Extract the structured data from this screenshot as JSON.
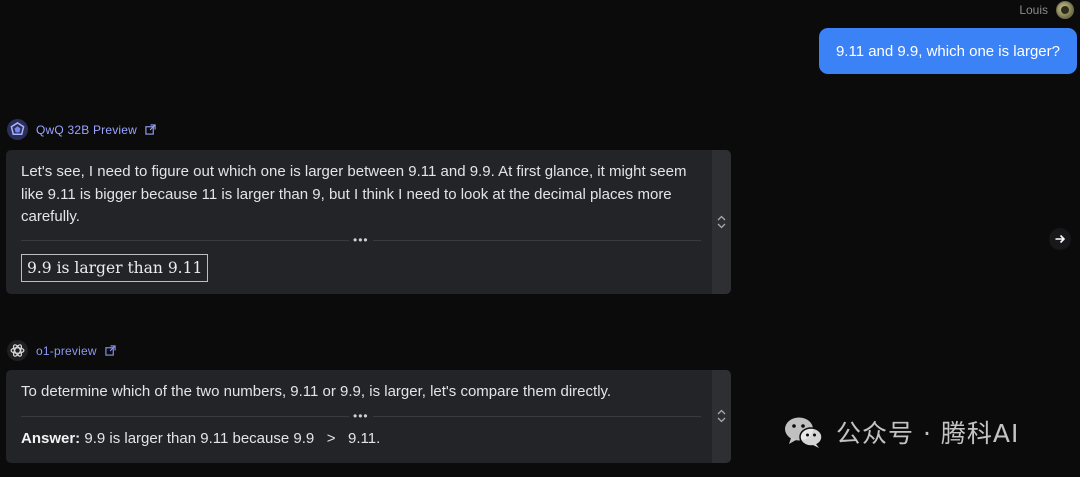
{
  "user": {
    "name": "Louis",
    "message": "9.11 and 9.9, which one is larger?"
  },
  "responses": [
    {
      "model": "QwQ 32B Preview",
      "text": "Let's see, I need to figure out which one is larger between 9.11 and 9.9. At first glance, it might seem like 9.11 is bigger because 11 is larger than 9, but I think I need to look at the decimal places more carefully.",
      "collapsed_indicator": "•••",
      "boxed_answer": "9.9 is larger than 9.11"
    },
    {
      "model": "o1-preview",
      "text": "To determine which of the two numbers, 9.11 or 9.9, is larger, let's compare them directly.",
      "collapsed_indicator": "•••",
      "answer_label": "Answer:",
      "answer_text": " 9.9 is larger than 9.11 because 9.9   >   9.11."
    }
  ],
  "watermark": {
    "text": "公众号 · 腾科AI",
    "icon": "wechat-logo"
  },
  "icons": {
    "external_link": "external-link-icon",
    "expand": "chevron-up-down-icon",
    "next": "arrow-right-icon"
  },
  "colors": {
    "background": "#0b0b0c",
    "user_bubble": "#3b82f6",
    "card": "#232427",
    "model_name": "#9aa4ff"
  }
}
